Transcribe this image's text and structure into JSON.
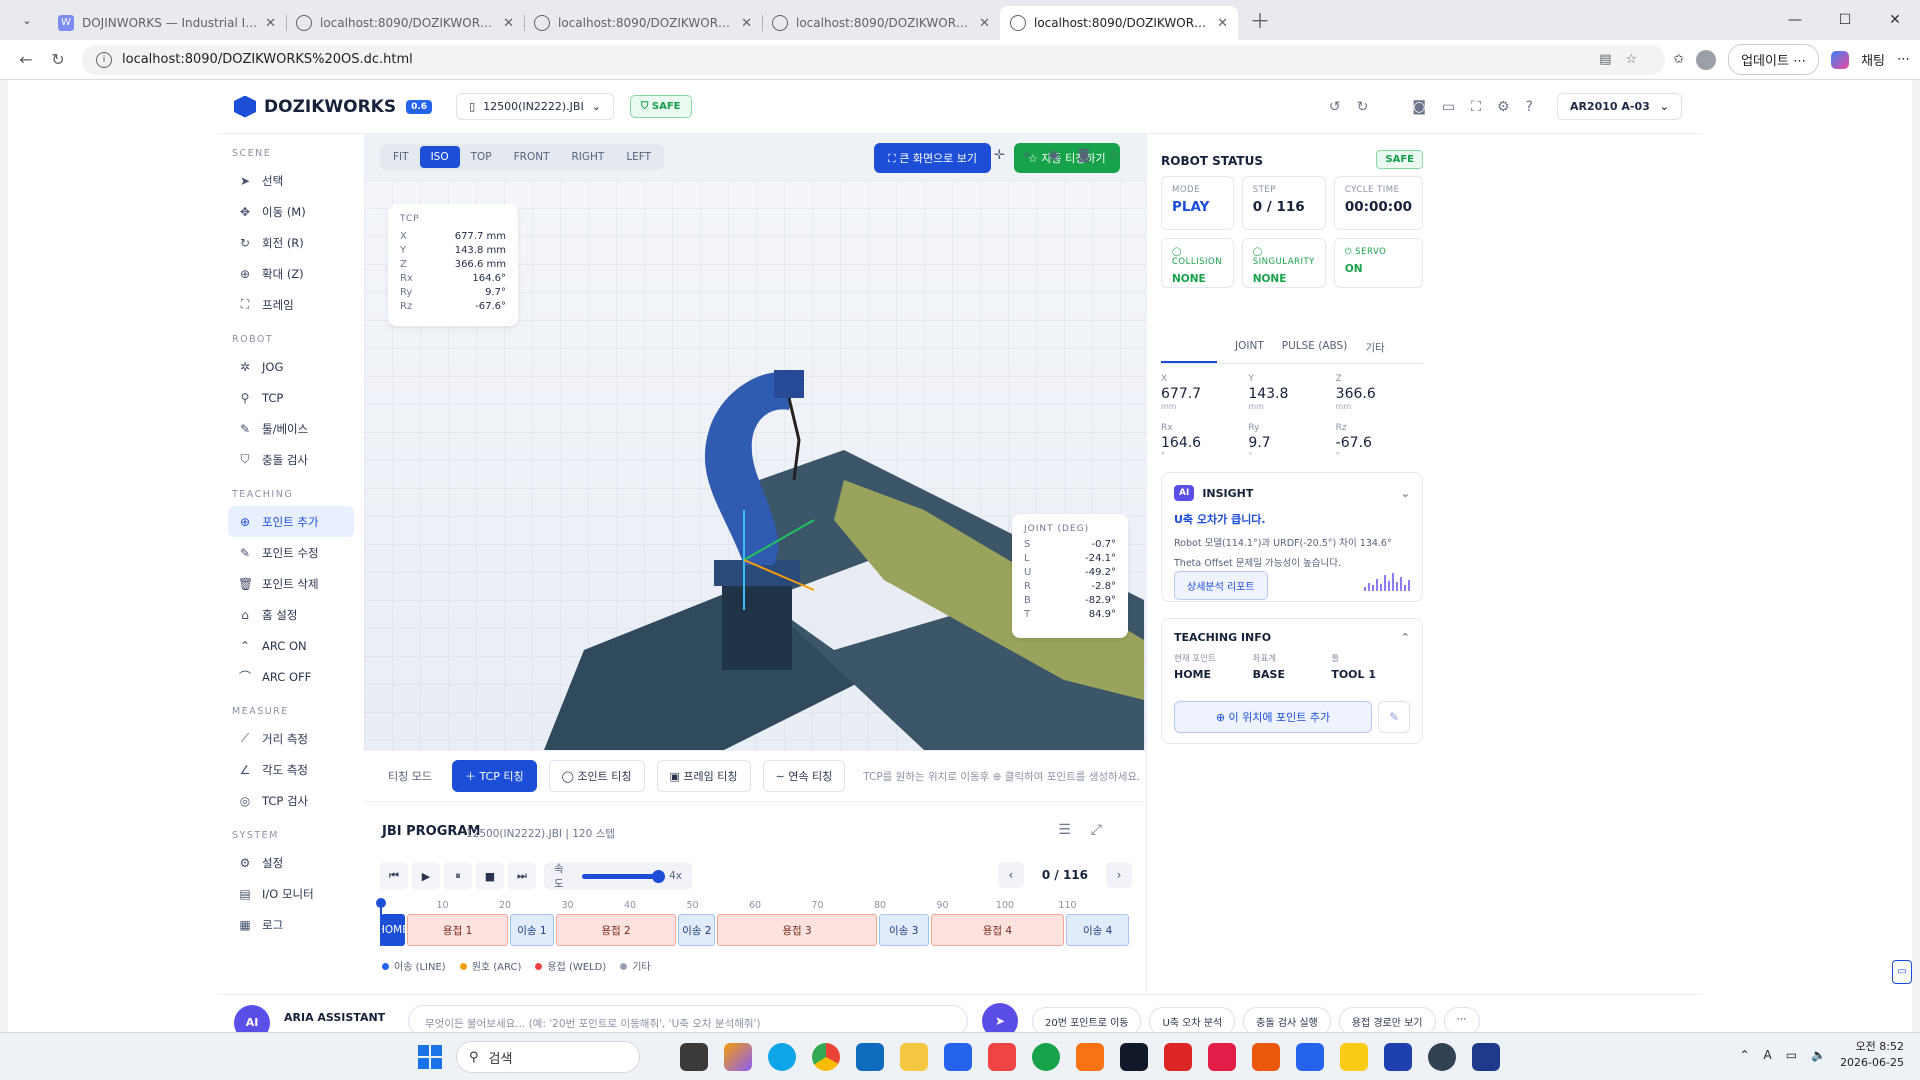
{
  "browser": {
    "tabs": [
      {
        "title": "DOJINWORKS — Industrial Intellig",
        "active": false,
        "favicon": "w-logo"
      },
      {
        "title": "localhost:8090/DOZIKWORKS OS.d",
        "active": false,
        "favicon": "globe-icon"
      },
      {
        "title": "localhost:8090/DOZIKWORKS OS.d",
        "active": false,
        "favicon": "globe-icon"
      },
      {
        "title": "localhost:8090/DOZIKWORKS_OS_",
        "active": false,
        "favicon": "globe-icon"
      },
      {
        "title": "localhost:8090/DOZIKWORKS OS.d",
        "active": true,
        "favicon": "globe-icon"
      }
    ],
    "url": "localhost:8090/DOZIKWORKS%20OS.dc.html",
    "update_label": "업데이트 ⋯",
    "chat_label": "채팅"
  },
  "app": {
    "brand": "DOZIKWORKS",
    "version": "0.6",
    "file": "12500(IN2222).JBI",
    "safe_label": "SAFE",
    "robot_select": "AR2010 A-03"
  },
  "sidebar": {
    "scene_title": "SCENE",
    "scene": [
      "선택",
      "이동 (M)",
      "회전 (R)",
      "확대 (Z)",
      "프레임"
    ],
    "robot_title": "ROBOT",
    "robot": [
      "JOG",
      "TCP",
      "툴/베이스",
      "충돌 검사"
    ],
    "teaching_title": "TEACHING",
    "teaching": [
      "포인트 추가",
      "포인트 수정",
      "포인트 삭제",
      "홈 설정",
      "ARC ON",
      "ARC OFF"
    ],
    "measure_title": "MEASURE",
    "measure": [
      "거리 측정",
      "각도 측정",
      "TCP 검사"
    ],
    "system_title": "SYSTEM",
    "system": [
      "설정",
      "I/O 모니터",
      "로그"
    ]
  },
  "viewport": {
    "views": [
      "FIT",
      "ISO",
      "TOP",
      "FRONT",
      "RIGHT",
      "LEFT"
    ],
    "active_view": "ISO",
    "fullscreen_label": "큰 화면으로 보기",
    "auto_teach_label": "자동 티칭하기",
    "tcp": {
      "title": "TCP",
      "rows": [
        {
          "k": "X",
          "v": "677.7 mm"
        },
        {
          "k": "Y",
          "v": "143.8 mm"
        },
        {
          "k": "Z",
          "v": "366.6 mm"
        },
        {
          "k": "Rx",
          "v": "164.6°"
        },
        {
          "k": "Ry",
          "v": "9.7°"
        },
        {
          "k": "Rz",
          "v": "-67.6°"
        }
      ]
    },
    "joint": {
      "title": "JOINT (DEG)",
      "rows": [
        {
          "k": "S",
          "v": "-0.7°"
        },
        {
          "k": "L",
          "v": "-24.1°"
        },
        {
          "k": "U",
          "v": "-49.2°"
        },
        {
          "k": "R",
          "v": "-2.8°"
        },
        {
          "k": "B",
          "v": "-82.9°"
        },
        {
          "k": "T",
          "v": "84.9°"
        }
      ]
    }
  },
  "teach_bar": {
    "label": "티칭 모드",
    "buttons": [
      "＋ TCP 티칭",
      "◯ 조인트 티칭",
      "▣ 프레임 티칭",
      "∼ 연속 티칭"
    ],
    "hint": "TCP를 원하는 위치로 이동후 ⊕ 클릭하여 포인트를 생성하세요."
  },
  "program": {
    "title": "JBI PROGRAM",
    "subtitle": "12500(IN2222).JBI | 120 스텝",
    "speed_label": "속도",
    "speed_value": "4x",
    "speed_fraction": 1.0,
    "position": "0 / 116",
    "ticks": [
      "10",
      "20",
      "30",
      "40",
      "50",
      "60",
      "70",
      "80",
      "90",
      "100",
      "110"
    ],
    "segments": [
      {
        "label": "HOME",
        "kind": "home",
        "start": 0,
        "end": 4
      },
      {
        "label": "용접 1",
        "kind": "weld",
        "start": 4,
        "end": 20
      },
      {
        "label": "이송 1",
        "kind": "line",
        "start": 20,
        "end": 27
      },
      {
        "label": "용접 2",
        "kind": "weld",
        "start": 27,
        "end": 46
      },
      {
        "label": "이송 2",
        "kind": "line",
        "start": 46,
        "end": 52
      },
      {
        "label": "용접 3",
        "kind": "weld",
        "start": 52,
        "end": 77
      },
      {
        "label": "이송 3",
        "kind": "line",
        "start": 77,
        "end": 85
      },
      {
        "label": "용접 4",
        "kind": "weld",
        "start": 85,
        "end": 106
      },
      {
        "label": "이송 4",
        "kind": "line",
        "start": 106,
        "end": 116
      }
    ],
    "legend": [
      {
        "label": "이송 (LINE)",
        "color": "#2563eb"
      },
      {
        "label": "원호 (ARC)",
        "color": "#f59e0b"
      },
      {
        "label": "용접 (WELD)",
        "color": "#ef4444"
      },
      {
        "label": "기타",
        "color": "#9aa3b5"
      }
    ]
  },
  "status": {
    "title": "ROBOT STATUS",
    "safe": "SAFE",
    "cards": [
      {
        "k": "MODE",
        "v": "PLAY"
      },
      {
        "k": "STEP",
        "v": "0 / 116"
      },
      {
        "k": "CYCLE TIME",
        "v": "00:00:00"
      }
    ],
    "checks": [
      {
        "k": "◯ COLLISION",
        "v": "NONE"
      },
      {
        "k": "◯ SINGULARITY",
        "v": "NONE"
      },
      {
        "k": "⏻ SERVO",
        "v": "ON"
      }
    ],
    "tabs": [
      "JOINT",
      "PULSE (ABS)",
      "기타"
    ],
    "coords": [
      {
        "k": "X",
        "v": "677.7",
        "u": "mm"
      },
      {
        "k": "Y",
        "v": "143.8",
        "u": "mm"
      },
      {
        "k": "Z",
        "v": "366.6",
        "u": "mm"
      },
      {
        "k": "Rx",
        "v": "164.6",
        "u": "°"
      },
      {
        "k": "Ry",
        "v": "9.7",
        "u": "°"
      },
      {
        "k": "Rz",
        "v": "-67.6",
        "u": "°"
      }
    ]
  },
  "insight": {
    "badge": "AI",
    "title": "INSIGHT",
    "headline": "U축 오차가 큽니다.",
    "line1": "Robot 모델(114.1°)과 URDF(-20.5°) 차이 134.6°",
    "line2": "Theta Offset 문제일 가능성이 높습니다.",
    "button": "상세분석 리포트"
  },
  "teaching_info": {
    "title": "TEACHING INFO",
    "fields": [
      {
        "k": "현재 포인트",
        "v": "HOME"
      },
      {
        "k": "좌표계",
        "v": "BASE"
      },
      {
        "k": "툴",
        "v": "TOOL 1"
      }
    ],
    "add_button": "⊕ 이 위치에 포인트 추가"
  },
  "assistant": {
    "avatar": "AI",
    "name": "ARIA ASSISTANT",
    "placeholder": "무엇이든 물어보세요... (예: '20번 포인트로 이동해줘', 'U축 오차 분석해줘')",
    "quick": [
      "20번 포인트로 이동",
      "U축 오차 분석",
      "충돌 검사 실행",
      "용접 경로만 보기"
    ]
  },
  "taskbar": {
    "search": "검색",
    "time": "오전 8:52",
    "date": "2026-06-25"
  }
}
